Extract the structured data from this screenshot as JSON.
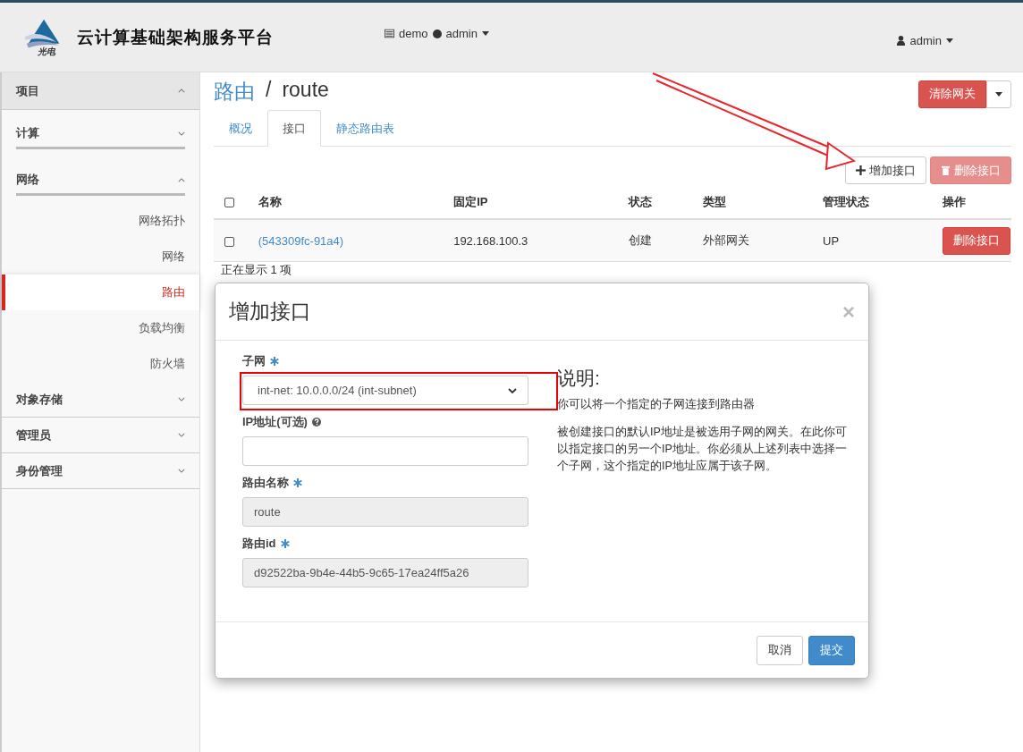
{
  "header": {
    "brand": "云计算基础架构服务平台",
    "logo_caption": "光电",
    "project_selector": {
      "project": "demo",
      "user": "admin"
    },
    "user_menu": "admin"
  },
  "sidebar": {
    "sections": [
      {
        "label": "项目",
        "expanded": true
      },
      {
        "label": "计算",
        "expanded": false
      },
      {
        "label": "网络",
        "expanded": true,
        "children": [
          {
            "label": "网络拓扑",
            "selected": false
          },
          {
            "label": "网络",
            "selected": false
          },
          {
            "label": "路由",
            "selected": true
          },
          {
            "label": "负载均衡",
            "selected": false
          },
          {
            "label": "防火墙",
            "selected": false
          }
        ]
      },
      {
        "label": "对象存储",
        "expanded": false
      },
      {
        "label": "管理员",
        "expanded": false
      },
      {
        "label": "身份管理",
        "expanded": false
      }
    ]
  },
  "page": {
    "breadcrumb": "路由",
    "separator": "/",
    "title": "route",
    "clear_gateway": "清除网关"
  },
  "tabs": [
    {
      "label": "概况",
      "selected": false
    },
    {
      "label": "接口",
      "selected": true
    },
    {
      "label": "静态路由表",
      "selected": false
    }
  ],
  "actions": [
    {
      "label": "增加接口",
      "kind": "add",
      "disabled": false
    },
    {
      "label": "删除接口",
      "kind": "delete",
      "disabled": true
    }
  ],
  "table": {
    "select_all": false,
    "columns": [
      "名称",
      "固定IP",
      "状态",
      "类型",
      "管理状态",
      "操作"
    ],
    "rows": [
      {
        "checked": false,
        "name": "(543309fc-91a4)",
        "ip": "192.168.100.3",
        "status": "创建",
        "type": "外部网关",
        "admin_state": "UP",
        "action": "删除接口"
      }
    ],
    "footer": "正在显示 1 项"
  },
  "modal": {
    "title": "增加接口",
    "close": "×",
    "fields": [
      {
        "label": {
          "text": "子网",
          "kind": "required"
        },
        "kind": "select",
        "value": "int-net: 10.0.0.0/24 (int-subnet)"
      },
      {
        "label": {
          "text": "IP地址(可选)",
          "kind": "help"
        },
        "kind": "text"
      },
      {
        "label": {
          "text": "路由名称",
          "kind": "required"
        },
        "kind": "readonly",
        "value": "route"
      },
      {
        "label": {
          "text": "路由id",
          "kind": "required"
        },
        "kind": "readonly",
        "value": "d92522ba-9b4e-44b5-9c65-17ea24ff5a26"
      }
    ],
    "description_title": "说明:",
    "description": [
      "你可以将一个指定的子网连接到路由器",
      "被创建接口的默认IP地址是被选用子网的网关。在此你可以指定接口的另一个IP地址。你必须从上述列表中选择一个子网，这个指定的IP地址应属于该子网。"
    ],
    "buttons": [
      {
        "label": "取消",
        "kind": "default"
      },
      {
        "label": "提交",
        "kind": "primary"
      }
    ]
  }
}
